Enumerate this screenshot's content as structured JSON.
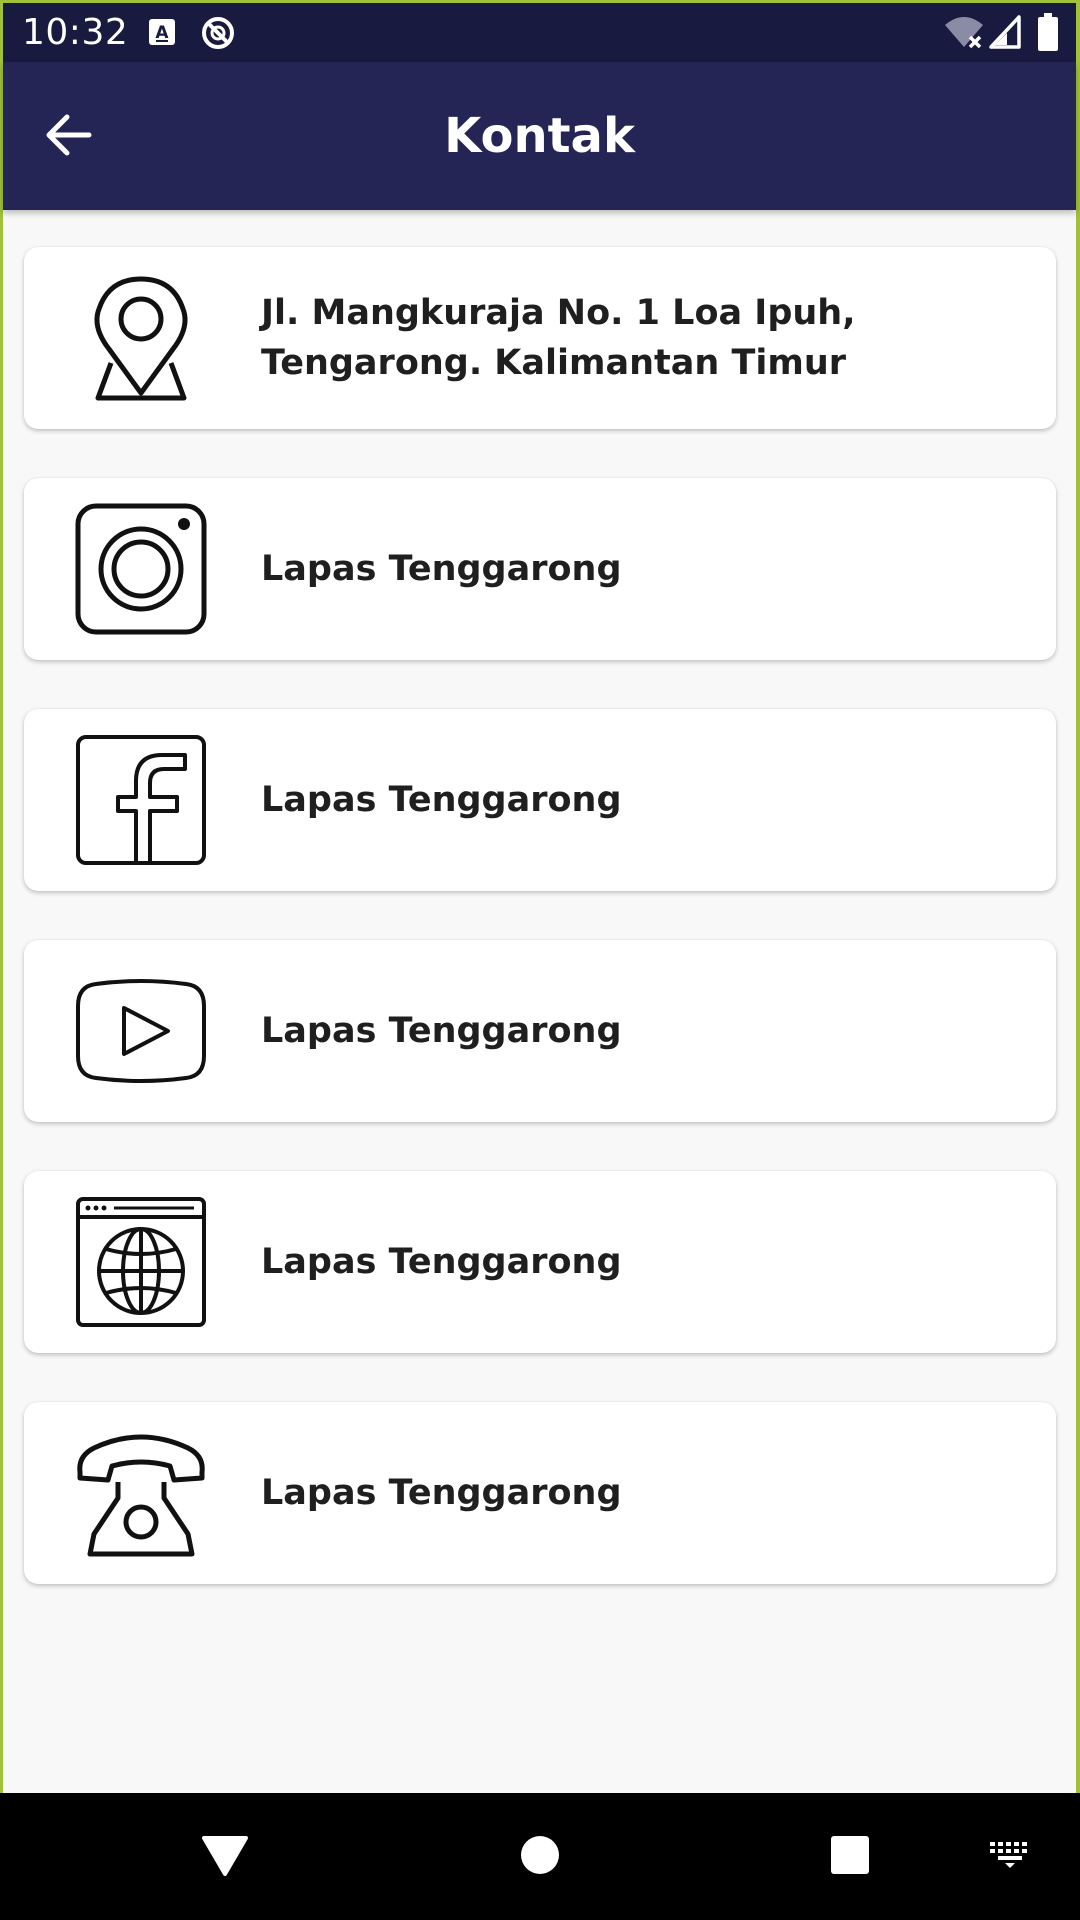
{
  "status_bar": {
    "time": "10:32"
  },
  "app_bar": {
    "title": "Kontak",
    "back_icon": "arrow-left-icon"
  },
  "contacts": [
    {
      "icon": "map-pin-icon",
      "text": "Jl. Mangkuraja No. 1 Loa Ipuh, Tengarong. Kalimantan Timur"
    },
    {
      "icon": "instagram-icon",
      "text": "Lapas Tenggarong"
    },
    {
      "icon": "facebook-icon",
      "text": "Lapas Tenggarong"
    },
    {
      "icon": "youtube-icon",
      "text": "Lapas Tenggarong"
    },
    {
      "icon": "website-globe-icon",
      "text": "Lapas Tenggarong"
    },
    {
      "icon": "telephone-icon",
      "text": "Lapas Tenggarong"
    }
  ],
  "colors": {
    "status_bar": "#181a40",
    "app_bar": "#242455",
    "background": "#f8f8f8",
    "card": "#ffffff",
    "text": "#1f1f1f"
  }
}
